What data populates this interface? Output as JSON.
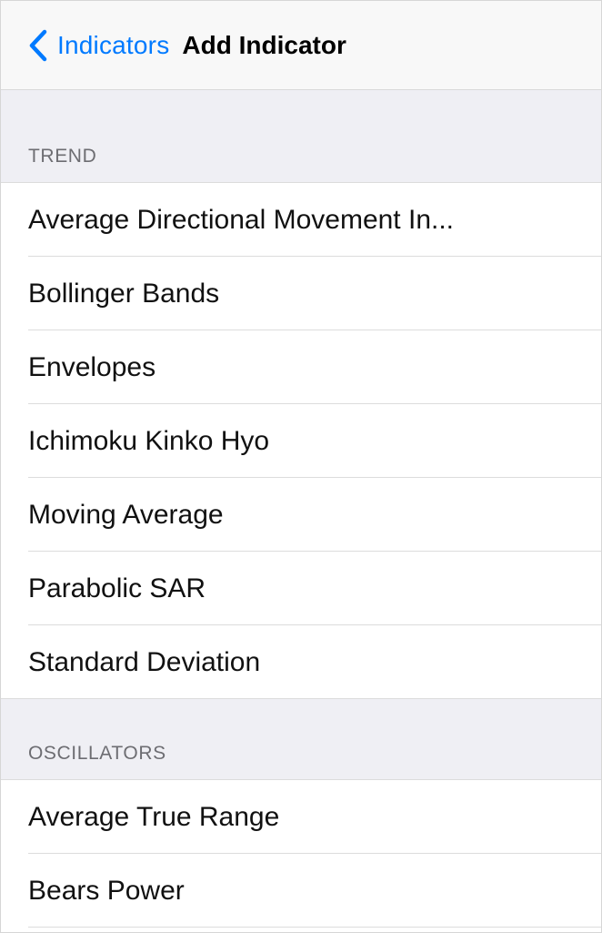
{
  "navbar": {
    "back_label": "Indicators",
    "back_icon": "chevron-left-icon",
    "title": "Add Indicator",
    "accent_color": "#007aff"
  },
  "sections": [
    {
      "title": "TREND",
      "items": [
        {
          "label": "Average Directional Movement In..."
        },
        {
          "label": "Bollinger Bands"
        },
        {
          "label": "Envelopes"
        },
        {
          "label": "Ichimoku Kinko Hyo"
        },
        {
          "label": "Moving Average"
        },
        {
          "label": "Parabolic SAR"
        },
        {
          "label": "Standard Deviation"
        }
      ]
    },
    {
      "title": "OSCILLATORS",
      "items": [
        {
          "label": "Average True Range"
        },
        {
          "label": "Bears Power"
        }
      ]
    }
  ],
  "colors": {
    "section_background": "#efeff4",
    "section_text": "#6d6d72",
    "separator": "#dcdcdc"
  }
}
